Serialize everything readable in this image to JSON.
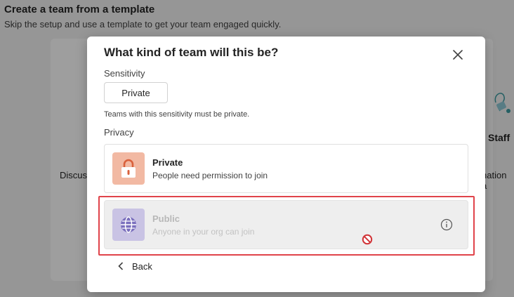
{
  "background": {
    "title": "Create a team from a template",
    "subtitle": "Skip the setup and use a template to get your team engaged quickly.",
    "card_left_text": "Discuss",
    "card_right_title": "Staff",
    "card_right_text": "nation a"
  },
  "dialog": {
    "title": "What kind of team will this be?",
    "close_icon": "close-icon",
    "sensitivity_label": "Sensitivity",
    "sensitivity_value": "Private",
    "sensitivity_hint": "Teams with this sensitivity must be private.",
    "privacy_label": "Privacy",
    "options": [
      {
        "title": "Private",
        "description": "People need permission to join",
        "icon": "lock-icon",
        "enabled": true
      },
      {
        "title": "Public",
        "description": "Anyone in your org can join",
        "icon": "globe-icon",
        "enabled": false
      }
    ],
    "back_label": "Back"
  },
  "colors": {
    "private_icon_bg": "#f2b9a3",
    "private_icon_fg": "#d9603b",
    "public_icon_bg": "#c9c3e4",
    "public_icon_fg": "#7a6fbd",
    "highlight": "#e0434a",
    "not_allowed": "#d13438"
  }
}
